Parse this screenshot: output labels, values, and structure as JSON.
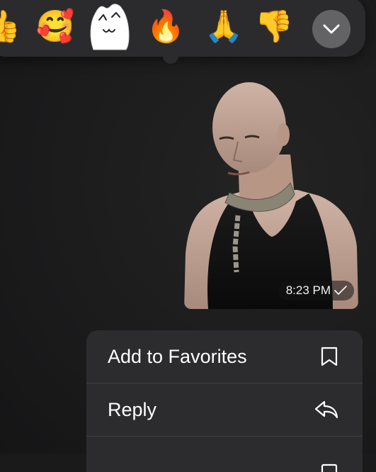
{
  "reactions": [
    {
      "name": "thumbs-up",
      "glyph": "👍"
    },
    {
      "name": "smiling-face-with-hearts",
      "glyph": "🥰"
    },
    {
      "name": "custom-sticker"
    },
    {
      "name": "fire",
      "glyph": "🔥"
    },
    {
      "name": "folded-hands",
      "glyph": "🙏"
    },
    {
      "name": "thumbs-down",
      "glyph": "👎"
    }
  ],
  "reaction_expand_icon": "chevron-down-icon",
  "message": {
    "time": "8:23 PM",
    "status_icon": "checkmark-icon"
  },
  "menu": {
    "items": [
      {
        "label": "Add to Favorites",
        "icon": "bookmark-icon"
      },
      {
        "label": "Reply",
        "icon": "reply-arrow-icon"
      },
      {
        "icon": "copy-icon"
      }
    ]
  },
  "colors": {
    "background": "#1a1a1b",
    "reaction_bar": "#2b2b2d",
    "expand_button": "#636366",
    "menu_background": "#2c2c2e",
    "menu_text": "#ffffff",
    "separator": "#404043"
  }
}
